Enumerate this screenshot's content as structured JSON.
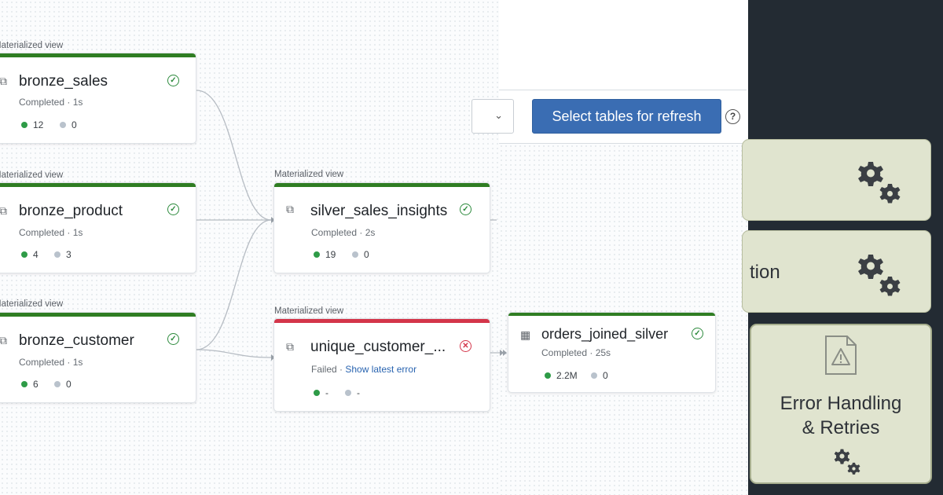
{
  "graph": {
    "nodes": [
      {
        "type_label": "Materialized view",
        "name": "bronze_sales",
        "status_text": "Completed · 1s",
        "status": "ok",
        "stat1": "12",
        "stat2": "0"
      },
      {
        "type_label": "Materialized view",
        "name": "bronze_product",
        "status_text": "Completed · 1s",
        "status": "ok",
        "stat1": "4",
        "stat2": "3"
      },
      {
        "type_label": "Materialized view",
        "name": "bronze_customer",
        "status_text": "Completed · 1s",
        "status": "ok",
        "stat1": "6",
        "stat2": "0"
      },
      {
        "type_label": "Materialized view",
        "name": "silver_sales_insights",
        "status_text": "Completed · 2s",
        "status": "ok",
        "stat1": "19",
        "stat2": "0"
      },
      {
        "type_label": "Materialized view",
        "name": "unique_customer_...",
        "status_text": "Failed · ",
        "status_link": "Show latest error",
        "status": "fail",
        "stat1": "-",
        "stat2": "-"
      },
      {
        "type_label": "",
        "name": "orders_joined_silver",
        "status_text": "Completed · 25s",
        "status": "ok",
        "stat1": "2.2M",
        "stat2": "0"
      }
    ]
  },
  "toolbar": {
    "refresh_button": "Select tables for refresh",
    "help_glyph": "?",
    "dropdown_chevron": "⌄"
  },
  "icons": {
    "success": "✓",
    "failure": "✕",
    "view": "⧉",
    "table": "▦"
  },
  "overlay_panel": {
    "tiles": [
      {
        "label": "",
        "icon": "gears-icon"
      },
      {
        "label": "tion",
        "icon": "gears-icon"
      },
      {
        "label_line1": "Error Handling",
        "label_line2": "& Retries",
        "icon": "warning-document-icon"
      }
    ]
  },
  "colors": {
    "success_bar": "#2f7d22",
    "failure_bar": "#d4354a",
    "primary_button": "#3a6db3",
    "panel_dark": "#232b33",
    "tile_bg": "#e0e4cf"
  }
}
